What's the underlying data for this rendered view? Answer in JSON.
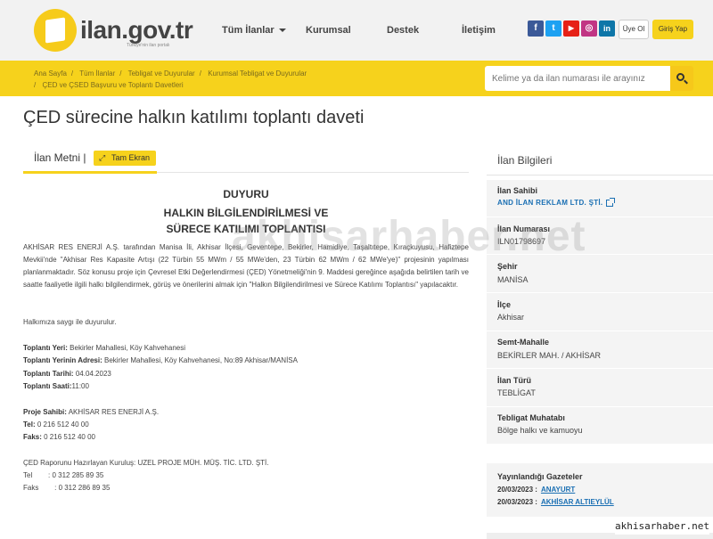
{
  "header": {
    "logo_text": "ilan.gov.tr",
    "logo_sub": "Türkiye'nin ilan portalı",
    "nav": [
      "Tüm İlanlar",
      "Kurumsal",
      "Destek",
      "İletişim"
    ],
    "social": [
      {
        "name": "facebook",
        "glyph": "f",
        "color": "#3b5998"
      },
      {
        "name": "twitter",
        "glyph": "t",
        "color": "#1da1f2"
      },
      {
        "name": "youtube",
        "glyph": "▶",
        "color": "#e62117"
      },
      {
        "name": "instagram",
        "glyph": "◎",
        "color": "#c13584"
      },
      {
        "name": "linkedin",
        "glyph": "in",
        "color": "#0e76a8"
      }
    ],
    "uye_ol": "Üye Ol",
    "giris_yap": "Giriş Yap"
  },
  "breadcrumb": {
    "items": [
      "Ana Sayfa",
      "Tüm İlanlar",
      "Tebligat ve Duyurular",
      "Kurumsal Tebligat ve Duyurular"
    ],
    "last": "ÇED ve ÇSED Başvuru ve Toplantı Davetleri"
  },
  "search": {
    "placeholder": "Kelime ya da ilan numarası ile arayınız"
  },
  "page_title": "ÇED sürecine halkın katılımı toplantı daveti",
  "tabs": {
    "ilan_metni": "İlan Metni |",
    "tam_ekran": "Tam Ekran"
  },
  "announcement": {
    "title1": "DUYURU",
    "title2": "HALKIN BİLGİLENDİRİLMESİ VE",
    "title3": "SÜRECE KATILIMI TOPLANTISI",
    "body": "AKHİSAR RES ENERJİ A.Ş. tarafından Manisa İli, Akhisar İlçesi, Geventepe, Bekirler, Hamidiye, Taşaltıtepe, Kıraçkuyusu, Hafiztepe Mevkii'nde \"Akhisar Res Kapasite Artışı (22 Türbin 55 MWm / 55 MWe'den, 23 Türbin 62 MWm / 62 MWe'ye)\" projesinin yapılması planlanmaktadır. Söz konusu proje için Çevresel Etki Değerlendirmesi (ÇED) Yönetmeliği'nin 9. Maddesi gereğince aşağıda belirtilen tarih ve saatte faaliyetle ilgili halkı bilgilendirmek, görüş ve önerilerini almak için \"Halkın Bilgilendirilmesi ve Sürece Katılımı Toplantısı\" yapılacaktır.",
    "greeting": "Halkımıza saygı ile duyurulur.",
    "yer_label": "Toplantı Yeri:",
    "yer_value": " Bekirler Mahallesi, Köy Kahvehanesi",
    "adres_label": "Toplantı Yerinin Adresi:",
    "adres_value": " Bekirler Mahallesi, Köy Kahvehanesi, No:89 Akhisar/MANİSA",
    "tarih_label": "Toplantı Tarihi:",
    "tarih_value": " 04.04.2023",
    "saat_label": "Toplantı Saati:",
    "saat_value": "11:00",
    "sahibi_label": "Proje Sahibi:",
    "sahibi_value": " AKHİSAR RES ENERJİ A.Ş.",
    "tel_label": "Tel:",
    "tel_value": " 0 216 512 40 00",
    "faks_label": "Faks:",
    "faks_value": "  0 216 512 40 00",
    "kurulus": "ÇED Raporunu Hazırlayan Kuruluş: UZEL PROJE MÜH. MÜŞ. TİC. LTD. ŞTİ.",
    "kurulus_tel": "Tel        : 0 312 285 89 35",
    "kurulus_faks": "Faks        : 0 312 286 89 35"
  },
  "sidebar": {
    "title": "İlan Bilgileri",
    "ilan_sahibi_label": "İlan Sahibi",
    "ilan_sahibi_value": "AND İLAN REKLAM LTD. ŞTİ.",
    "ilan_no_label": "İlan Numarası",
    "ilan_no_value": "ILN01798697",
    "sehir_label": "Şehir",
    "sehir_value": "MANİSA",
    "ilce_label": "İlçe",
    "ilce_value": "Akhisar",
    "semt_label": "Semt-Mahalle",
    "semt_value": "BEKİRLER MAH. / AKHİSAR",
    "tur_label": "İlan Türü",
    "tur_value": "TEBLİGAT",
    "muhatap_label": "Tebligat Muhatabı",
    "muhatap_value": "Bölge halkı ve kamuoyu",
    "gazete_title": "Yayınlandığı Gazeteler",
    "gazete1_date": "20/03/2023 :",
    "gazete1_name": "ANAYURT",
    "gazete2_date": "20/03/2023 :",
    "gazete2_name": "AKHİSAR ALTIEYLÜL"
  },
  "watermark": "akhisarhaber.net",
  "watermark_corner": "akhisarhaber.net"
}
